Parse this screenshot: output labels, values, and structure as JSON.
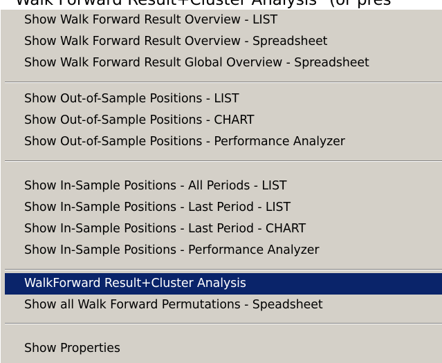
{
  "header": {
    "partial_title": "Walk Forward Result+Cluster Analysis\" (or pres"
  },
  "menu": {
    "items": [
      {
        "label": "Show Walk Forward Result Overview - LIST"
      },
      {
        "label": "Show Walk Forward Result Overview - Spreadsheet"
      },
      {
        "label": "Show Walk Forward Result Global Overview - Spreadsheet"
      },
      {
        "label": "Show Out-of-Sample Positions - LIST"
      },
      {
        "label": "Show Out-of-Sample Positions - CHART"
      },
      {
        "label": "Show Out-of-Sample Positions -  Performance Analyzer"
      },
      {
        "label": "Show In-Sample Positions - All Periods - LIST"
      },
      {
        "label": "Show In-Sample Positions - Last  Period - LIST"
      },
      {
        "label": "Show In-Sample Positions - Last Period - CHART"
      },
      {
        "label": "Show In-Sample Positions - Performance Analyzer"
      },
      {
        "label": "WalkForward Result+Cluster Analysis",
        "selected": true
      },
      {
        "label": "Show all Walk Forward Permutations - Speadsheet"
      },
      {
        "label": "Show Properties"
      }
    ]
  },
  "colors": {
    "menu_background": "#d4d0c8",
    "selection_background": "#0a246a",
    "selection_text": "#ffffff"
  }
}
